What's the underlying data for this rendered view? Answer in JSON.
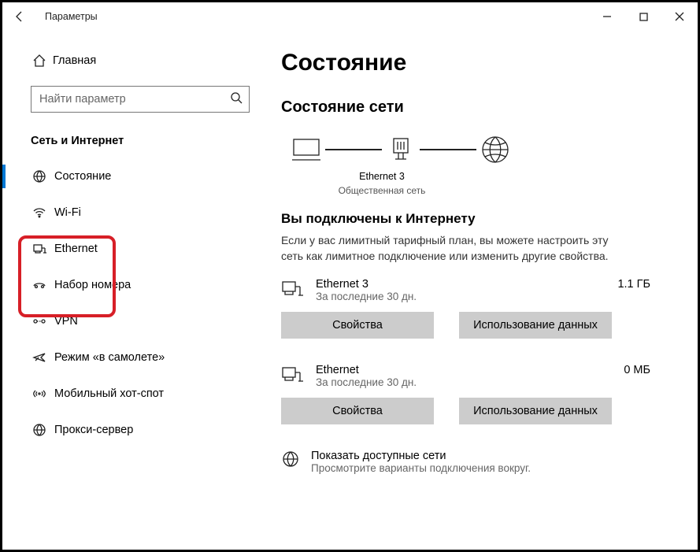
{
  "window": {
    "title": "Параметры"
  },
  "sidebar": {
    "home": "Главная",
    "search_placeholder": "Найти параметр",
    "category": "Сеть и Интернет",
    "items": [
      {
        "label": "Состояние"
      },
      {
        "label": "Wi-Fi"
      },
      {
        "label": "Ethernet"
      },
      {
        "label": "Набор номера"
      },
      {
        "label": "VPN"
      },
      {
        "label": "Режим «в самолете»"
      },
      {
        "label": "Мобильный хот-спот"
      },
      {
        "label": "Прокси-сервер"
      }
    ]
  },
  "main": {
    "title": "Состояние",
    "subtitle": "Состояние сети",
    "diagram": {
      "name": "Ethernet 3",
      "net_type": "Общественная сеть"
    },
    "connected_heading": "Вы подключены к Интернету",
    "connected_desc": "Если у вас лимитный тарифный план, вы можете настроить эту сеть как лимитное подключение или изменить другие свойства.",
    "connections": [
      {
        "name": "Ethernet 3",
        "period": "За последние 30 дн.",
        "usage": "1.1 ГБ"
      },
      {
        "name": "Ethernet",
        "period": "За последние 30 дн.",
        "usage": "0 МБ"
      }
    ],
    "btn_properties": "Свойства",
    "btn_data_usage": "Использование данных",
    "show_networks": {
      "title": "Показать доступные сети",
      "sub": "Просмотрите варианты подключения вокруг."
    }
  }
}
